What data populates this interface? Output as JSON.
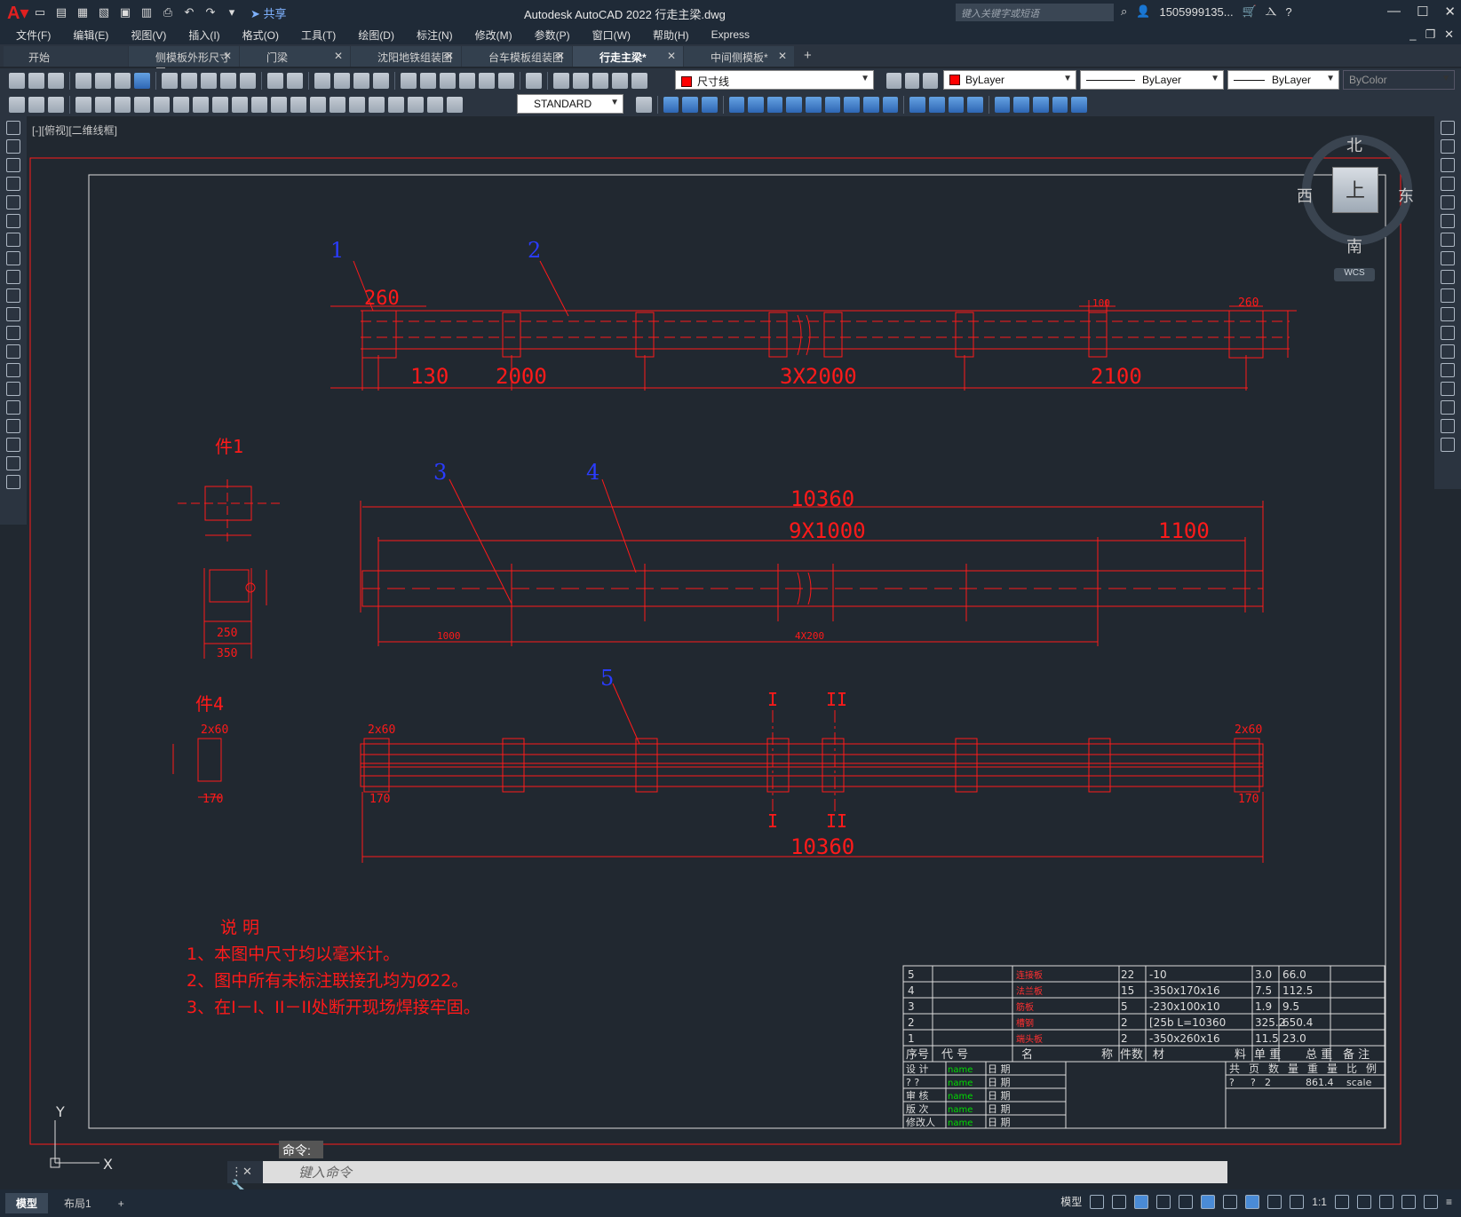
{
  "app": {
    "title": "Autodesk AutoCAD 2022    行走主梁.dwg",
    "share_label": "共享",
    "search_placeholder": "键入关键字或短语",
    "user": "1505999135..."
  },
  "menu": [
    "文件(F)",
    "编辑(E)",
    "视图(V)",
    "插入(I)",
    "格式(O)",
    "工具(T)",
    "绘图(D)",
    "标注(N)",
    "修改(M)",
    "参数(P)",
    "窗口(W)",
    "帮助(H)",
    "Express"
  ],
  "tabs": [
    {
      "label": "开始",
      "active": false,
      "closable": false
    },
    {
      "label": "侧模板外形尺寸图",
      "active": false,
      "closable": true
    },
    {
      "label": "门梁",
      "active": false,
      "closable": true
    },
    {
      "label": "沈阳地铁组装图",
      "active": false,
      "closable": true
    },
    {
      "label": "台车模板组装图",
      "active": false,
      "closable": true
    },
    {
      "label": "行走主梁*",
      "active": true,
      "closable": true
    },
    {
      "label": "中间侧模板*",
      "active": false,
      "closable": true
    }
  ],
  "properties": {
    "layer": "尺寸线",
    "color": "ByLayer",
    "linetype": "ByLayer",
    "lineweight": "ByLayer",
    "plotstyle": "ByColor",
    "textstyle": "STANDARD",
    "layer_color": "#ff0000"
  },
  "viewport_label": "[-][俯视][二维线框]",
  "viewcube": {
    "north": "北",
    "south": "南",
    "east": "东",
    "west": "西",
    "face": "上",
    "wcs": "WCS"
  },
  "drawing": {
    "line_color": "#ff1a1a",
    "balloon_color": "#2a3cff",
    "item_numbers": [
      "1",
      "2",
      "3",
      "4",
      "5"
    ],
    "top_view": {
      "dim_260": "260",
      "dim_130": "130",
      "dim_2000": "2000",
      "dim_3x2000": "3X2000",
      "dim_2100": "2100",
      "dim_100": "100",
      "dim_260b": "260"
    },
    "mid_view": {
      "overall": "10360",
      "pitch": "9X1000",
      "end": "1100",
      "dim_1000": "1000",
      "dim_4x200": "4X200"
    },
    "bottom_view": {
      "overall": "10360",
      "cut1": "I",
      "cut2": "II",
      "dim_2x60": "2x60",
      "dim_170": "170"
    },
    "part1_label": "件1",
    "part4_label": "件4",
    "part1_dims": {
      "d250": "250",
      "d350": "350"
    },
    "part4_dims": {
      "d2x60": "2x60",
      "d170": "170"
    },
    "notes_title": "说   明",
    "notes": [
      "1、本图中尺寸均以毫米计。",
      "2、图中所有未标注联接孔均为Ø22。",
      "3、在I－I、II－II处断开现场焊接牢固。"
    ]
  },
  "bom": {
    "rows": [
      {
        "no": "5",
        "name": "连接板",
        "qty": "22",
        "material": "-10",
        "unit": "3.0",
        "total": "66.0"
      },
      {
        "no": "4",
        "name": "法兰板",
        "qty": "15",
        "material": "-350x170x16",
        "unit": "7.5",
        "total": "112.5"
      },
      {
        "no": "3",
        "name": "筋板",
        "qty": "5",
        "material": "-230x100x10",
        "unit": "1.9",
        "total": "9.5"
      },
      {
        "no": "2",
        "name": "槽钢",
        "qty": "2",
        "material": "[25b L=10360",
        "unit": "325.2",
        "total": "650.4"
      },
      {
        "no": "1",
        "name": "端头板",
        "qty": "2",
        "material": "-350x260x16",
        "unit": "11.5",
        "total": "23.0"
      }
    ],
    "header": {
      "no": "序号",
      "code": "代   号",
      "name": "名",
      "name2": "称",
      "qty": "件数",
      "material": "材",
      "material2": "料",
      "unit": "单  重",
      "total": "总  重",
      "remark": "备  注"
    },
    "title_block": {
      "design": "设  计",
      "check": "?  ?",
      "review": "审  核",
      "version": "版  次",
      "modifier": "修改人",
      "date": "日  期",
      "name_placeholder": "name",
      "sheet_hdr": [
        "共",
        "页",
        "数",
        "量",
        "重",
        "量",
        "比",
        "例"
      ],
      "sheet_vals": [
        "?",
        "?",
        "2",
        "861.4",
        "scale"
      ]
    }
  },
  "command": {
    "history": "命令:",
    "placeholder": "键入命令"
  },
  "status": {
    "tabs": [
      "模型",
      "布局1"
    ],
    "model_label": "模型",
    "scale": "1:1"
  },
  "ucs": {
    "x": "X",
    "y": "Y"
  }
}
